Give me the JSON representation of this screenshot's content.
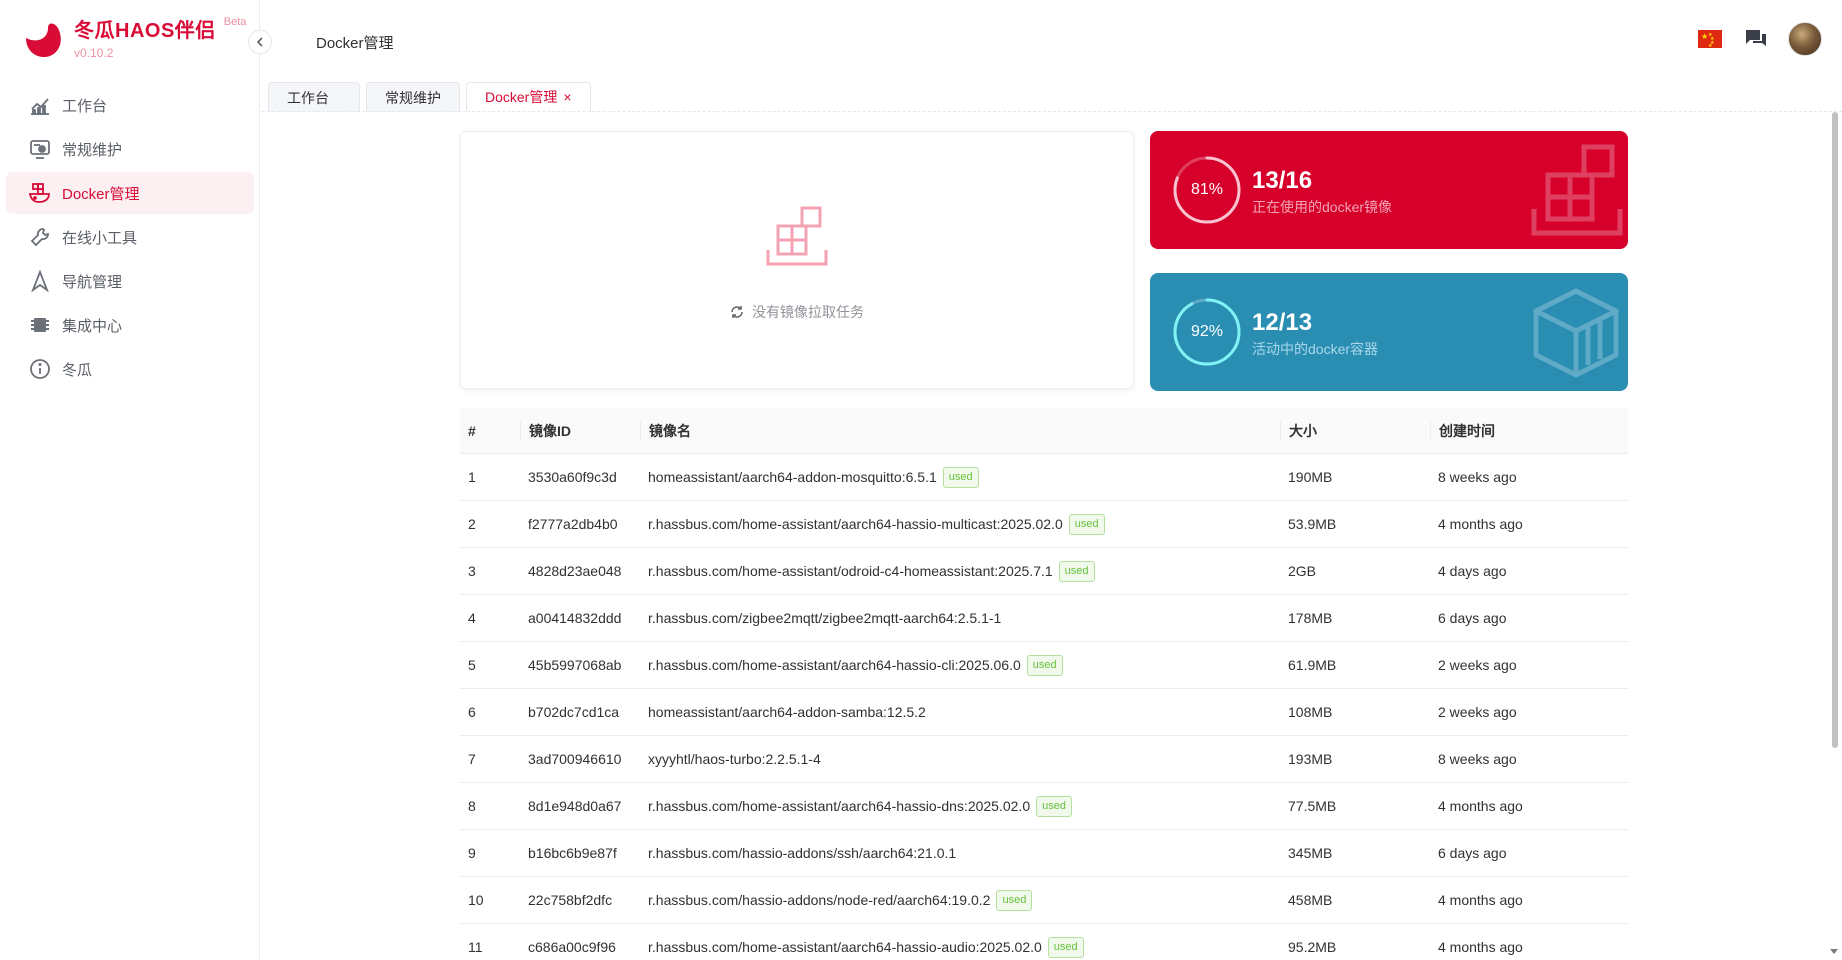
{
  "brand": {
    "title": "冬瓜HAOS伴侣",
    "beta": "Beta",
    "version": "v0.10.2",
    "color": "#d80c37"
  },
  "sidebar": {
    "items": [
      {
        "label": "工作台",
        "icon": "chart-line-icon"
      },
      {
        "label": "常规维护",
        "icon": "maintenance-icon"
      },
      {
        "label": "Docker管理",
        "icon": "docker-icon",
        "active": true
      },
      {
        "label": "在线小工具",
        "icon": "wrench-icon"
      },
      {
        "label": "导航管理",
        "icon": "navigation-icon"
      },
      {
        "label": "集成中心",
        "icon": "integration-icon"
      },
      {
        "label": "冬瓜",
        "icon": "info-icon"
      }
    ]
  },
  "header": {
    "title": "Docker管理"
  },
  "tabs": [
    {
      "label": "工作台"
    },
    {
      "label": "常规维护"
    },
    {
      "label": "Docker管理",
      "active": true,
      "close": "×"
    }
  ],
  "pull": {
    "text": "没有镜像拉取任务"
  },
  "stats": {
    "images": {
      "percent": "81%",
      "fraction": 0.81,
      "value": "13/16",
      "label": "正在使用的docker镜像",
      "color": "#d6002b"
    },
    "containers": {
      "percent": "92%",
      "fraction": 0.92,
      "value": "12/13",
      "label": "活动中的docker容器",
      "color": "#2a8eb3"
    }
  },
  "table": {
    "headers": {
      "idx": "#",
      "id": "镜像ID",
      "name": "镜像名",
      "size": "大小",
      "time": "创建时间"
    },
    "used_label": "used",
    "rows": [
      {
        "idx": "1",
        "id": "3530a60f9c3d",
        "name": "homeassistant/aarch64-addon-mosquitto:6.5.1",
        "used": true,
        "size": "190MB",
        "time": "8 weeks ago"
      },
      {
        "idx": "2",
        "id": "f2777a2db4b0",
        "name": "r.hassbus.com/home-assistant/aarch64-hassio-multicast:2025.02.0",
        "used": true,
        "size": "53.9MB",
        "time": "4 months ago"
      },
      {
        "idx": "3",
        "id": "4828d23ae048",
        "name": "r.hassbus.com/home-assistant/odroid-c4-homeassistant:2025.7.1",
        "used": true,
        "size": "2GB",
        "time": "4 days ago"
      },
      {
        "idx": "4",
        "id": "a00414832ddd",
        "name": "r.hassbus.com/zigbee2mqtt/zigbee2mqtt-aarch64:2.5.1-1",
        "used": false,
        "size": "178MB",
        "time": "6 days ago"
      },
      {
        "idx": "5",
        "id": "45b5997068ab",
        "name": "r.hassbus.com/home-assistant/aarch64-hassio-cli:2025.06.0",
        "used": true,
        "size": "61.9MB",
        "time": "2 weeks ago"
      },
      {
        "idx": "6",
        "id": "b702dc7cd1ca",
        "name": "homeassistant/aarch64-addon-samba:12.5.2",
        "used": false,
        "size": "108MB",
        "time": "2 weeks ago"
      },
      {
        "idx": "7",
        "id": "3ad700946610",
        "name": "xyyyhtl/haos-turbo:2.2.5.1-4",
        "used": false,
        "size": "193MB",
        "time": "8 weeks ago"
      },
      {
        "idx": "8",
        "id": "8d1e948d0a67",
        "name": "r.hassbus.com/home-assistant/aarch64-hassio-dns:2025.02.0",
        "used": true,
        "size": "77.5MB",
        "time": "4 months ago"
      },
      {
        "idx": "9",
        "id": "b16bc6b9e87f",
        "name": "r.hassbus.com/hassio-addons/ssh/aarch64:21.0.1",
        "used": false,
        "size": "345MB",
        "time": "6 days ago"
      },
      {
        "idx": "10",
        "id": "22c758bf2dfc",
        "name": "r.hassbus.com/hassio-addons/node-red/aarch64:19.0.2",
        "used": true,
        "size": "458MB",
        "time": "4 months ago"
      },
      {
        "idx": "11",
        "id": "c686a00c9f96",
        "name": "r.hassbus.com/home-assistant/aarch64-hassio-audio:2025.02.0",
        "used": true,
        "size": "95.2MB",
        "time": "4 months ago"
      }
    ]
  }
}
